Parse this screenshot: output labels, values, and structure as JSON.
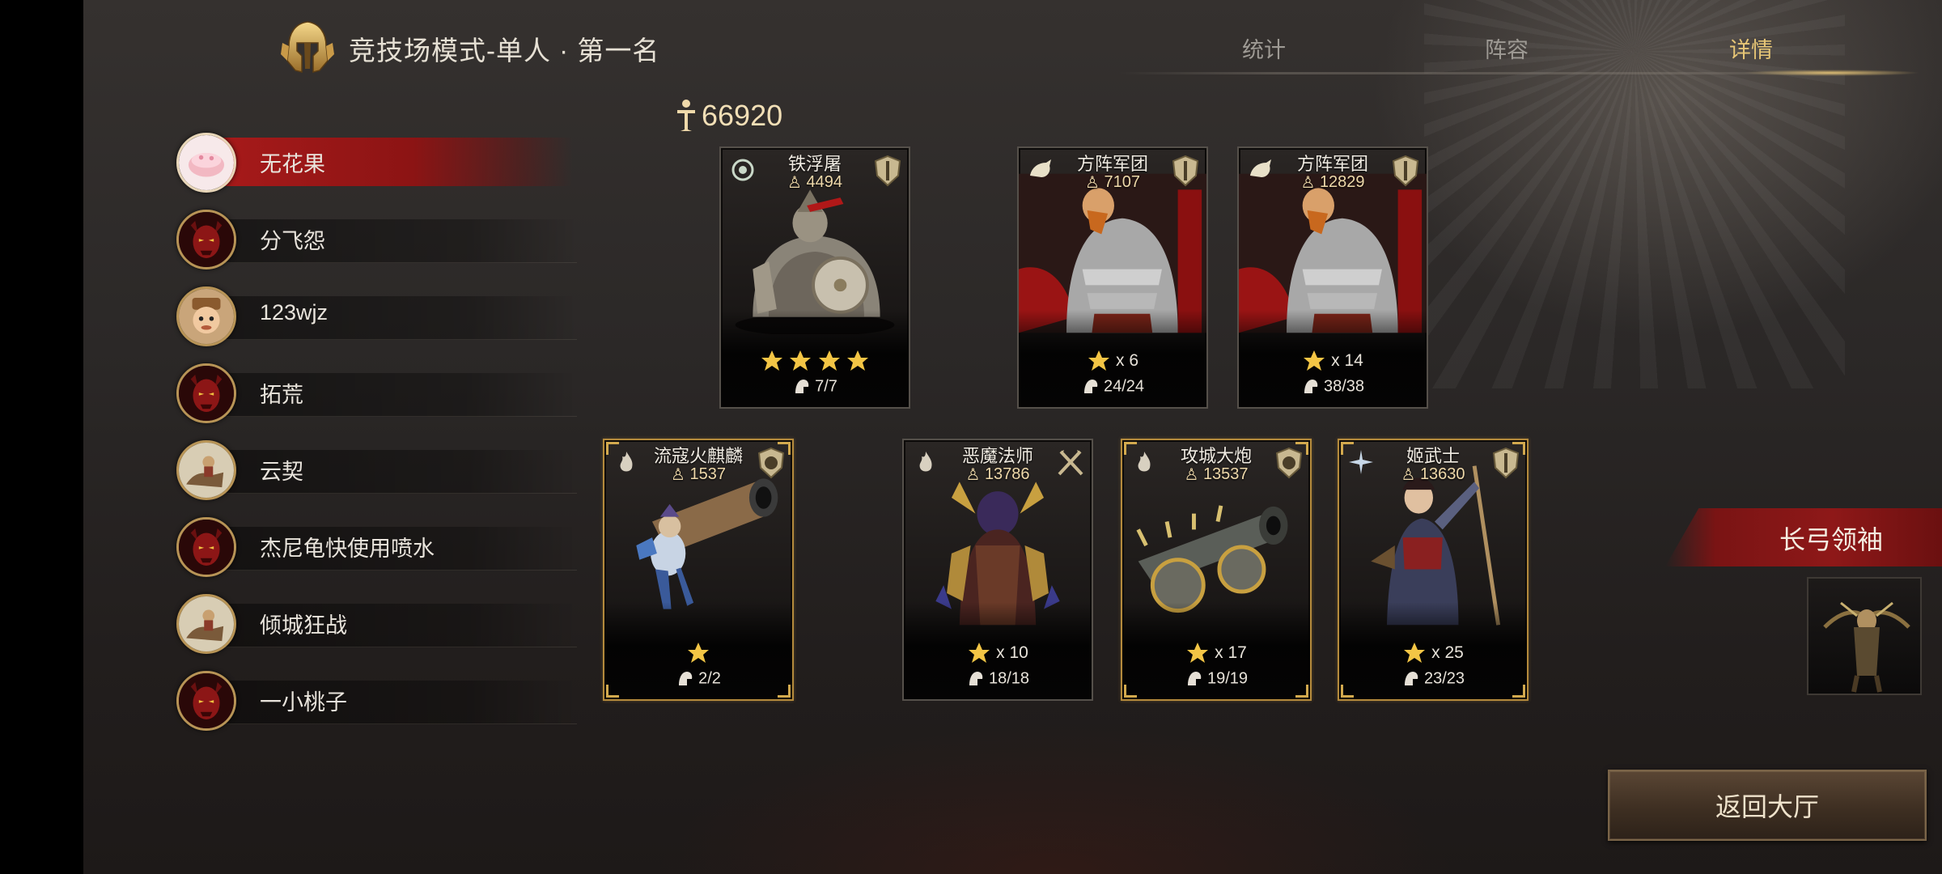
{
  "header": {
    "title": "竞技场模式-单人 · 第一名",
    "tabs": [
      {
        "label": "统计",
        "active": false
      },
      {
        "label": "阵容",
        "active": false
      },
      {
        "label": "详情",
        "active": true
      }
    ]
  },
  "players": [
    {
      "name": "无花果",
      "selected": true,
      "avatar": "pink-cake-avatar"
    },
    {
      "name": "分飞怨",
      "selected": false,
      "avatar": "red-demon-avatar"
    },
    {
      "name": "123wjz",
      "selected": false,
      "avatar": "cartoon-soldier-avatar"
    },
    {
      "name": "拓荒",
      "selected": false,
      "avatar": "red-demon-avatar"
    },
    {
      "name": "云契",
      "selected": false,
      "avatar": "cavalry-avatar"
    },
    {
      "name": "杰尼龟快使用喷水",
      "selected": false,
      "avatar": "red-demon-avatar"
    },
    {
      "name": "倾城狂战",
      "selected": false,
      "avatar": "cavalry-avatar"
    },
    {
      "name": "一小桃子",
      "selected": false,
      "avatar": "red-demon-avatar"
    }
  ],
  "total_power": "66920",
  "cards": [
    {
      "name": "铁浮屠",
      "power": "4494",
      "stars": 4,
      "multiplier": "",
      "troops": "7/7",
      "gold": false,
      "type_icon": "cavalry-icon",
      "class_icon": "shield-class-icon",
      "art": "heavy-cavalry"
    },
    {
      "name": "方阵军团",
      "power": "7107",
      "stars": 1,
      "multiplier": "x 6",
      "troops": "24/24",
      "gold": false,
      "type_icon": "horse-icon",
      "class_icon": "shield-class-icon",
      "art": "legionary"
    },
    {
      "name": "方阵军团",
      "power": "12829",
      "stars": 1,
      "multiplier": "x 14",
      "troops": "38/38",
      "gold": false,
      "type_icon": "horse-icon",
      "class_icon": "shield-class-icon",
      "art": "legionary"
    },
    {
      "name": "流寇火麒麟",
      "power": "1537",
      "stars": 1,
      "multiplier": "",
      "troops": "2/2",
      "gold": true,
      "type_icon": "flame-icon",
      "class_icon": "cannon-class-icon",
      "art": "cannoneer"
    },
    {
      "name": "恶魔法师",
      "power": "13786",
      "stars": 1,
      "multiplier": "x 10",
      "troops": "18/18",
      "gold": false,
      "type_icon": "flame-icon",
      "class_icon": "crossed-swords-class-icon",
      "art": "demon-mage"
    },
    {
      "name": "攻城大炮",
      "power": "13537",
      "stars": 1,
      "multiplier": "x 17",
      "troops": "19/19",
      "gold": true,
      "type_icon": "flame-icon",
      "class_icon": "cannon-class-icon",
      "art": "siege-cannon"
    },
    {
      "name": "姬武士",
      "power": "13630",
      "stars": 1,
      "multiplier": "x 25",
      "troops": "23/23",
      "gold": true,
      "type_icon": "spark-icon",
      "class_icon": "shield-class-icon",
      "art": "samurai"
    }
  ],
  "leader": {
    "name": "长弓领袖"
  },
  "back_button": {
    "label": "返回大厅"
  },
  "colors": {
    "accent_gold": "#e7c676",
    "selected_red": "#a71a1a",
    "card_gold_border": "#b48a3c"
  }
}
